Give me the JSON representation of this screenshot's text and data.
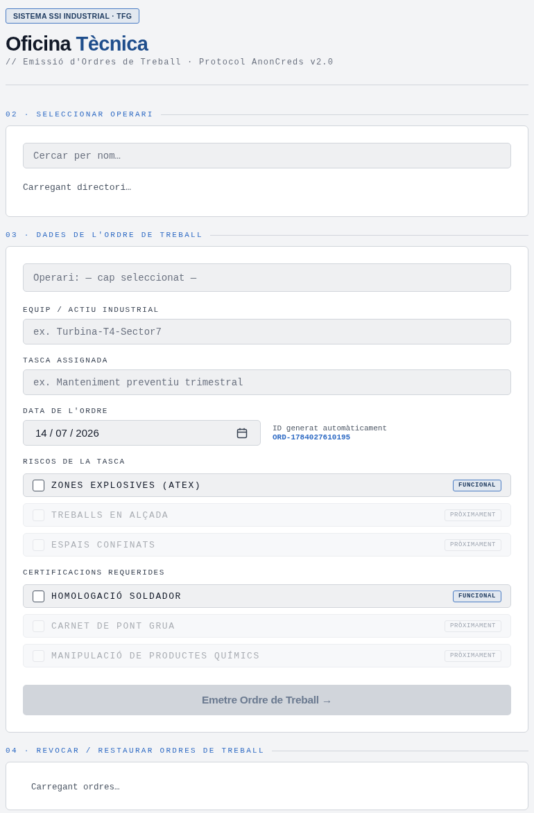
{
  "header": {
    "badge": "SISTEMA SSI INDUSTRIAL · TFG",
    "title": "Oficina",
    "title_accent": "Tècnica",
    "subtitle": "// Emissió d'Ordres de Treball · Protocol AnonCreds v2.0"
  },
  "sections": [
    {
      "kind": "operator_picker",
      "heading": "02 · SELECCIONAR OPERARI",
      "search": {
        "placeholder": "Cercar per nom…"
      },
      "status": "Carregant directori…"
    },
    {
      "kind": "order_form",
      "heading": "03 · DADES DE L'ORDRE DE TREBALL",
      "operator": "Operari: — cap seleccionat —",
      "fields": [
        {
          "label": "EQUIP / ACTIU INDUSTRIAL",
          "placeholder": "ex. Turbina-T4-Sector7"
        },
        {
          "label": "TASCA ASSIGNADA",
          "placeholder": "ex. Manteniment preventiu trimestral"
        }
      ],
      "date": {
        "label": "DATA DE L'ORDRE",
        "value": "14 / 07 / 2026"
      },
      "generated_id": {
        "caption": "ID generat automàticament",
        "value": "ORD-1784027610195"
      },
      "groups": [
        {
          "label": "RISCOS DE LA TASCA",
          "options": [
            {
              "label": "ZONES EXPLOSIVES (ATEX)",
              "checked": false,
              "disabled": false,
              "badge": "FUNCIONAL"
            },
            {
              "label": "TREBALLS EN ALÇADA",
              "checked": false,
              "disabled": true,
              "badge": "PRÒXIMAMENT"
            },
            {
              "label": "ESPAIS CONFINATS",
              "checked": false,
              "disabled": true,
              "badge": "PRÒXIMAMENT"
            }
          ]
        },
        {
          "label": "CERTIFICACIONS REQUERIDES",
          "options": [
            {
              "label": "HOMOLOGACIÓ SOLDADOR",
              "checked": false,
              "disabled": false,
              "badge": "FUNCIONAL"
            },
            {
              "label": "CARNET DE PONT GRUA",
              "checked": false,
              "disabled": true,
              "badge": "PRÒXIMAMENT"
            },
            {
              "label": "MANIPULACIÓ DE PRODUCTES QUÍMICS",
              "checked": false,
              "disabled": true,
              "badge": "PRÒXIMAMENT"
            }
          ]
        }
      ],
      "submit": {
        "label": "Emetre Ordre de Treball →",
        "disabled": true
      }
    },
    {
      "kind": "revocation",
      "heading": "04 · REVOCAR / RESTAURAR ORDRES DE TREBALL",
      "status": "Carregant ordres…"
    }
  ]
}
